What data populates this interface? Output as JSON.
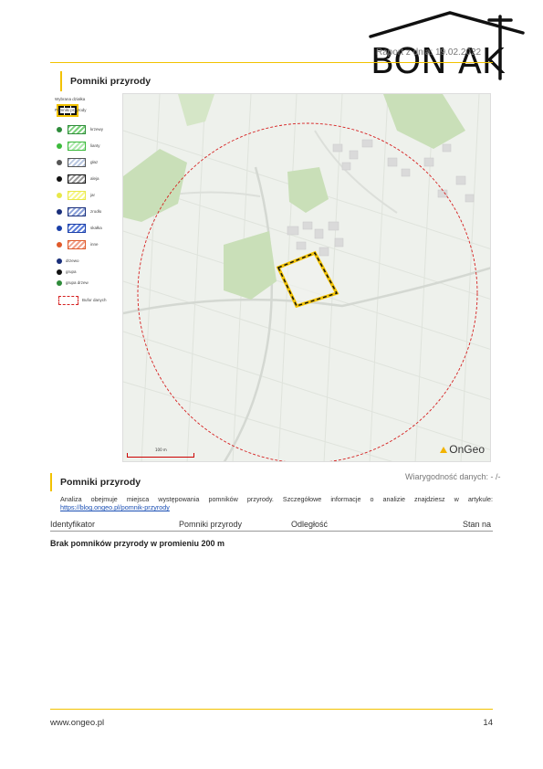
{
  "header": {
    "logo_text": "BON AK",
    "report_date": "Raport z dnia: 19.02.2022"
  },
  "section": {
    "title": "Pomniki przyrody"
  },
  "legend": {
    "items": [
      {
        "label": "Wybrana działka",
        "swatch": "outline"
      },
      {
        "label": "Pomniki przyrody",
        "swatch": "header"
      },
      {
        "label": "krzewy",
        "swatch": "hatch",
        "dot": "#2e8b3a",
        "fill": "#7ad17a"
      },
      {
        "label": "lianty",
        "swatch": "hatch",
        "dot": "#3cba3c",
        "fill": "#aee8ae"
      },
      {
        "label": "głaz",
        "swatch": "hatch",
        "dot": "#555555",
        "fill": "#b9c7e0"
      },
      {
        "label": "aleja",
        "swatch": "hatch",
        "dot": "#111111",
        "fill": "#999999"
      },
      {
        "label": "jar",
        "swatch": "hatch",
        "dot": "#e8e84a",
        "fill": "#f7f78a"
      },
      {
        "label": "zrodło",
        "swatch": "hatch",
        "dot": "#1a2f7a",
        "fill": "#8aa0d8"
      },
      {
        "label": "skałka",
        "swatch": "hatch",
        "dot": "#1a3fa8",
        "fill": "#5a7cd8"
      },
      {
        "label": "inne",
        "swatch": "hatch",
        "dot": "#e05a2a",
        "fill": "#f0a08a"
      },
      {
        "label": "drzewo",
        "swatch": "dot",
        "dot": "#1a2f7a"
      },
      {
        "label": "grupa",
        "swatch": "dot",
        "dot": "#111111"
      },
      {
        "label": "grupa drzew",
        "swatch": "dot",
        "dot": "#2e8b3a"
      },
      {
        "label": "Bufor danych",
        "swatch": "buffer"
      }
    ]
  },
  "map": {
    "scale_label": "100 m",
    "attribution": "OnGeo",
    "colors": {
      "buffer": "#d62020",
      "parcel_border": "#111111",
      "parcel_highlight": "#f2c200",
      "green_area": "#c9dfb8",
      "base": "#eef1ec"
    }
  },
  "analysis": {
    "reliability": "Wiarygodność danych: - /-",
    "title": "Pomniki przyrody",
    "description": "Analiza obejmuje miejsca występowania pomników przyrody. Szczegółowe informacje o analizie znajdziesz w artykule:",
    "link": "https://blog.ongeo.pl/pomnik-przyrody",
    "link_suffix": ".",
    "columns": [
      "Identyfikator",
      "Pomniki przyrody",
      "Odległość",
      "Stan na"
    ],
    "empty_message": "Brak pomników przyrody w promieniu 200 m"
  },
  "footer": {
    "url": "www.ongeo.pl",
    "page": "14"
  }
}
